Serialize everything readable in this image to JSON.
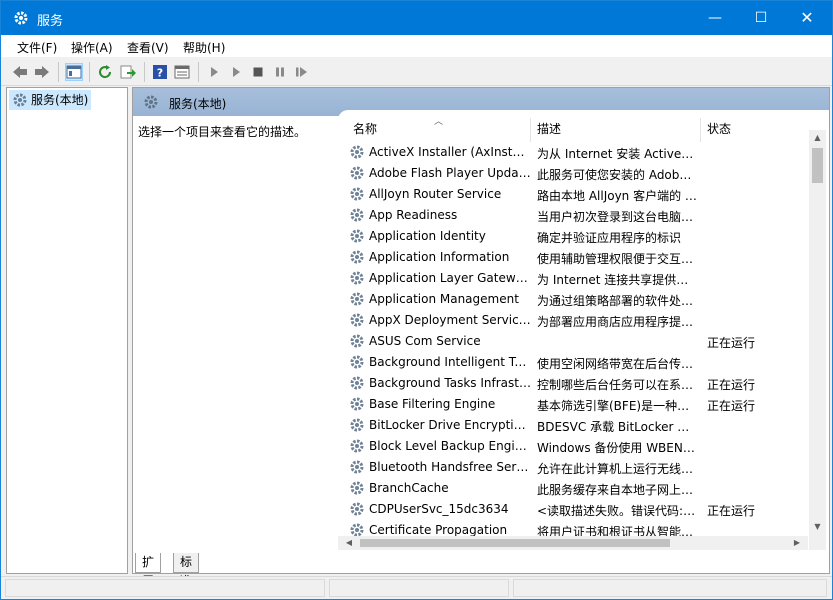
{
  "window": {
    "title": "服务",
    "app_icon": "services-gear-icon",
    "controls": {
      "minimize": "—",
      "maximize": "☐",
      "close": "✕"
    }
  },
  "menu": [
    {
      "label": "文件(F)"
    },
    {
      "label": "操作(A)"
    },
    {
      "label": "查看(V)"
    },
    {
      "label": "帮助(H)"
    }
  ],
  "toolbar": {
    "icons": [
      "back-icon",
      "forward-icon",
      "show-hide-console-tree-icon",
      "refresh-icon",
      "export-list-icon",
      "help-icon",
      "properties-icon",
      "start-icon",
      "start-alt-icon",
      "stop-icon",
      "pause-icon",
      "restart-icon"
    ]
  },
  "tree": {
    "selected_item": "服务(本地)"
  },
  "main": {
    "header_title": "服务(本地)",
    "description_prompt": "选择一个项目来查看它的描述。",
    "columns": {
      "name": "名称",
      "description": "描述",
      "status": "状态"
    },
    "services": [
      {
        "name": "ActiveX Installer (AxInstSV)",
        "description": "为从 Internet 安装 ActiveX 控件提供用户帐户控制验证",
        "status": ""
      },
      {
        "name": "Adobe Flash Player Update Service",
        "description": "此服务可使您安装的 Adobe Flash Player 保持最新",
        "status": ""
      },
      {
        "name": "AllJoyn Router Service",
        "description": "路由本地 AllJoyn 客户端的 AllJoyn 消息",
        "status": ""
      },
      {
        "name": "App Readiness",
        "description": "当用户初次登录到这台电脑时准备应用",
        "status": ""
      },
      {
        "name": "Application Identity",
        "description": "确定并验证应用程序的标识",
        "status": ""
      },
      {
        "name": "Application Information",
        "description": "使用辅助管理权限便于交互式应用程序的运行",
        "status": ""
      },
      {
        "name": "Application Layer Gateway Service",
        "description": "为 Internet 连接共享提供第三方协议插件的支持",
        "status": ""
      },
      {
        "name": "Application Management",
        "description": "为通过组策略部署的软件处理安装、删除以及枚举请求",
        "status": ""
      },
      {
        "name": "AppX Deployment Service (AppXSVC)",
        "description": "为部署应用商店应用程序提供基础结构支持",
        "status": ""
      },
      {
        "name": "ASUS Com Service",
        "description": "",
        "status": "正在运行"
      },
      {
        "name": "Background Intelligent Transfer Service",
        "description": "使用空闲网络带宽在后台传送文件",
        "status": ""
      },
      {
        "name": "Background Tasks Infrastructure Service",
        "description": "控制哪些后台任务可以在系统上运行的 Windows 基础结构服务",
        "status": "正在运行"
      },
      {
        "name": "Base Filtering Engine",
        "description": "基本筛选引擎(BFE)是一种管理防火墙和 Internet 协议安全策略的服务",
        "status": "正在运行"
      },
      {
        "name": "BitLocker Drive Encryption Service",
        "description": "BDESVC 承载 BitLocker 驱动器加密服务",
        "status": ""
      },
      {
        "name": "Block Level Backup Engine Service",
        "description": "Windows 备份使用 WBENGINE 服务执行备份和恢复操作",
        "status": ""
      },
      {
        "name": "Bluetooth Handsfree Service",
        "description": "允许在此计算机上运行无线蓝牙耳机",
        "status": ""
      },
      {
        "name": "BranchCache",
        "description": "此服务缓存来自本地子网上对等方的网络内容",
        "status": ""
      },
      {
        "name": "CDPUserSvc_15dc3634",
        "description": "<读取描述失败。错误代码: 15100 >",
        "status": "正在运行"
      },
      {
        "name": "Certificate Propagation",
        "description": "将用户证书和根证书从智能卡复制到当前用户的证书存储",
        "status": ""
      }
    ]
  },
  "tabs": [
    {
      "label": "扩展",
      "active": true
    },
    {
      "label": "标准",
      "active": false
    }
  ],
  "colors": {
    "titlebar": "#0078d7",
    "header_gradient": "#a7bfdb",
    "selection": "#cce8ff"
  }
}
